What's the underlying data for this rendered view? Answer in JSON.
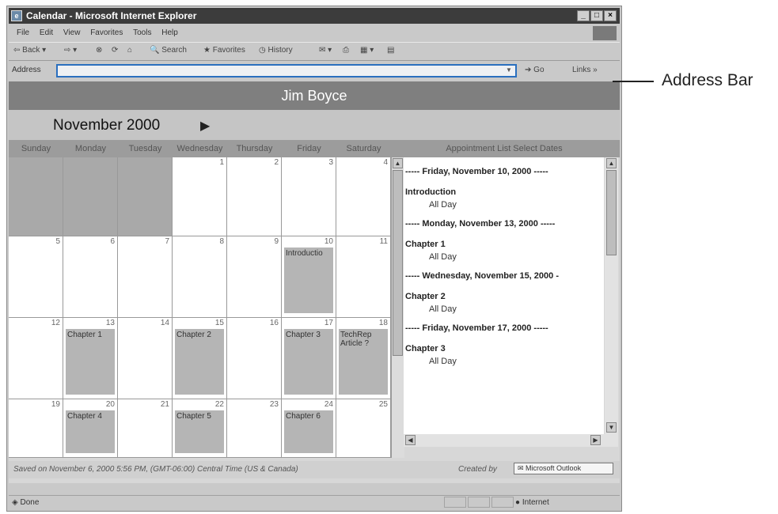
{
  "window": {
    "title": "Calendar - Microsoft Internet Explorer"
  },
  "menu": [
    "File",
    "Edit",
    "View",
    "Favorites",
    "Tools",
    "Help"
  ],
  "toolbar": {
    "back": "Back",
    "search": "Search",
    "favorites": "Favorites",
    "history": "History"
  },
  "address": {
    "label": "Address",
    "value": "",
    "go": "Go",
    "links": "Links"
  },
  "page": {
    "banner": "Jim Boyce",
    "month_title": "November 2000",
    "day_headers": [
      "Sunday",
      "Monday",
      "Tuesday",
      "Wednesday",
      "Thursday",
      "Friday",
      "Saturday"
    ],
    "appt_header": "Appointment List Select Dates",
    "weeks": [
      [
        {
          "num": "",
          "blank": true
        },
        {
          "num": "",
          "blank": true
        },
        {
          "num": "",
          "blank": true
        },
        {
          "num": "1"
        },
        {
          "num": "2"
        },
        {
          "num": "3"
        },
        {
          "num": "4"
        }
      ],
      [
        {
          "num": "5"
        },
        {
          "num": "6"
        },
        {
          "num": "7"
        },
        {
          "num": "8"
        },
        {
          "num": "9"
        },
        {
          "num": "10",
          "event": "Introductio"
        },
        {
          "num": "11"
        }
      ],
      [
        {
          "num": "12"
        },
        {
          "num": "13",
          "event": "Chapter 1"
        },
        {
          "num": "14"
        },
        {
          "num": "15",
          "event": "Chapter 2"
        },
        {
          "num": "16"
        },
        {
          "num": "17",
          "event": "Chapter 3"
        },
        {
          "num": "18",
          "event": "TechRep Article ?"
        }
      ],
      [
        {
          "num": "19"
        },
        {
          "num": "20",
          "event": "Chapter 4"
        },
        {
          "num": "21"
        },
        {
          "num": "22",
          "event": "Chapter 5"
        },
        {
          "num": "23"
        },
        {
          "num": "24",
          "event": "Chapter 6"
        },
        {
          "num": "25"
        }
      ]
    ],
    "appointments": [
      {
        "date": "----- Friday, November 10, 2000 -----",
        "items": [
          {
            "name": "Introduction",
            "time": "All Day"
          }
        ]
      },
      {
        "date": "----- Monday, November 13, 2000 -----",
        "items": [
          {
            "name": "Chapter 1",
            "time": "All Day"
          }
        ]
      },
      {
        "date": "----- Wednesday, November 15, 2000 -",
        "items": [
          {
            "name": "Chapter 2",
            "time": "All Day"
          }
        ]
      },
      {
        "date": "----- Friday, November 17, 2000 -----",
        "items": [
          {
            "name": "Chapter 3",
            "time": "All Day"
          }
        ]
      }
    ],
    "footer_saved": "Saved on November 6, 2000 5:56 PM, (GMT-06:00) Central Time (US & Canada)",
    "footer_created": "Created by",
    "outlook_badge": "Microsoft Outlook"
  },
  "status": {
    "text": "Done",
    "zone": "Internet"
  },
  "callout": "Address Bar"
}
